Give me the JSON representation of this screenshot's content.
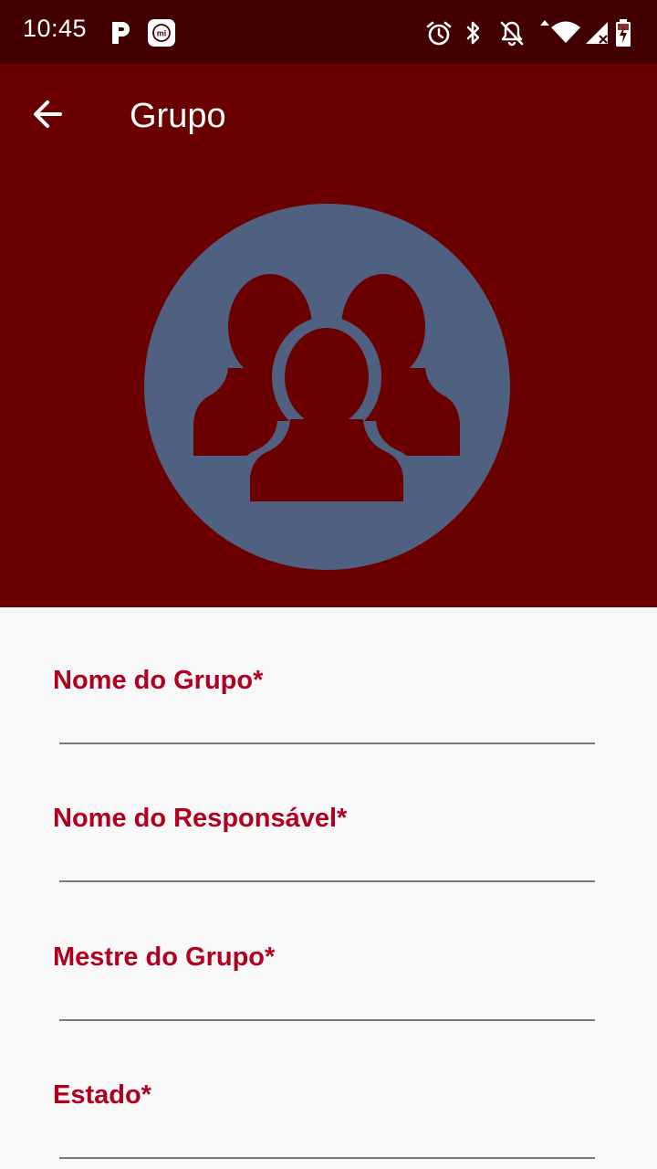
{
  "status_bar": {
    "time": "10:45",
    "icons": [
      "p-app-icon",
      "mi-app-icon",
      "alarm-icon",
      "bluetooth-icon",
      "notifications-off-icon",
      "wifi-icon",
      "signal-icon",
      "battery-charging-icon"
    ]
  },
  "app_bar": {
    "title": "Grupo",
    "back_icon": "arrow-back-icon"
  },
  "header": {
    "avatar_icon": "group-people-icon"
  },
  "form": {
    "fields": [
      {
        "label": "Nome do Grupo*",
        "value": ""
      },
      {
        "label": "Nome do Responsável*",
        "value": ""
      },
      {
        "label": "Mestre do Grupo*",
        "value": ""
      },
      {
        "label": "Estado*",
        "value": ""
      }
    ]
  },
  "colors": {
    "status_bar": "#430000",
    "app_bar": "#6b0000",
    "avatar_circle": "#4f6080",
    "label": "#b0001f",
    "background": "#f8f8f8"
  }
}
